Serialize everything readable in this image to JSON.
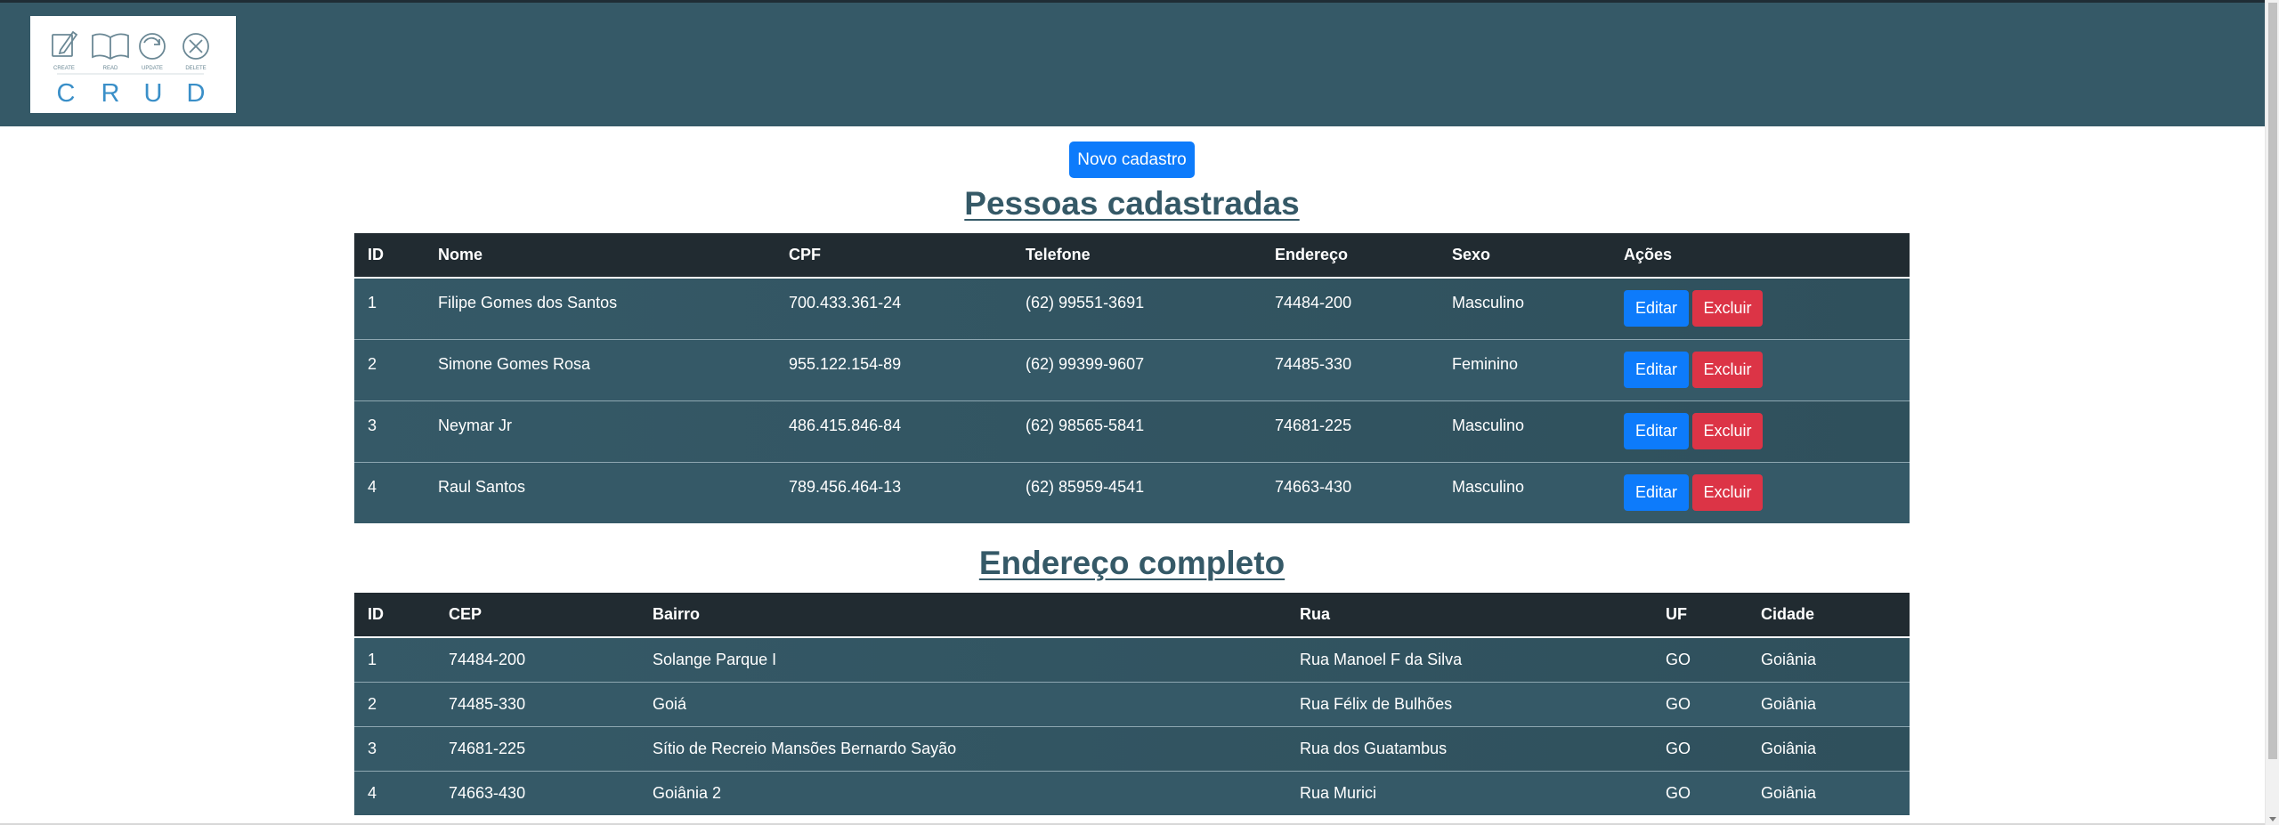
{
  "logo": {
    "ops": [
      "CREATE",
      "READ",
      "UPDATE",
      "DELETE"
    ],
    "letters": [
      "C",
      "R",
      "U",
      "D"
    ]
  },
  "actions": {
    "new_label": "Novo cadastro"
  },
  "people": {
    "title": "Pessoas cadastradas",
    "headers": [
      "ID",
      "Nome",
      "CPF",
      "Telefone",
      "Endereço",
      "Sexo",
      "Ações"
    ],
    "edit_label": "Editar",
    "delete_label": "Excluir",
    "rows": [
      {
        "id": "1",
        "nome": "Filipe Gomes dos Santos",
        "cpf": "700.433.361-24",
        "telefone": "(62) 99551-3691",
        "endereco": "74484-200",
        "sexo": "Masculino"
      },
      {
        "id": "2",
        "nome": "Simone Gomes Rosa",
        "cpf": "955.122.154-89",
        "telefone": "(62) 99399-9607",
        "endereco": "74485-330",
        "sexo": "Feminino"
      },
      {
        "id": "3",
        "nome": "Neymar Jr",
        "cpf": "486.415.846-84",
        "telefone": "(62) 98565-5841",
        "endereco": "74681-225",
        "sexo": "Masculino"
      },
      {
        "id": "4",
        "nome": "Raul Santos",
        "cpf": "789.456.464-13",
        "telefone": "(62) 85959-4541",
        "endereco": "74663-430",
        "sexo": "Masculino"
      }
    ]
  },
  "addresses": {
    "title": "Endereço completo",
    "headers": [
      "ID",
      "CEP",
      "Bairro",
      "Rua",
      "UF",
      "Cidade"
    ],
    "rows": [
      {
        "id": "1",
        "cep": "74484-200",
        "bairro": "Solange Parque I",
        "rua": "Rua Manoel F da Silva",
        "uf": "GO",
        "cidade": "Goiânia"
      },
      {
        "id": "2",
        "cep": "74485-330",
        "bairro": "Goiá",
        "rua": "Rua Félix de Bulhões",
        "uf": "GO",
        "cidade": "Goiânia"
      },
      {
        "id": "3",
        "cep": "74681-225",
        "bairro": "Sítio de Recreio Mansões Bernardo Sayão",
        "rua": "Rua dos Guatambus",
        "uf": "GO",
        "cidade": "Goiânia"
      },
      {
        "id": "4",
        "cep": "74663-430",
        "bairro": "Goiânia 2",
        "rua": "Rua Murici",
        "uf": "GO",
        "cidade": "Goiânia"
      }
    ]
  }
}
